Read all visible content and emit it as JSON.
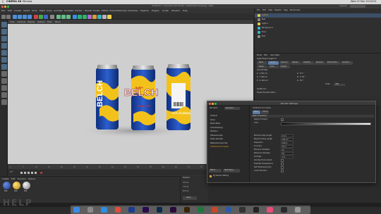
{
  "menubar": {
    "app": "CINEMA 4D",
    "window_menu": "Window",
    "clock": "Wed 22 Mar  10:23:01"
  },
  "titlebar": {
    "title": "Untitled 1 * [Cinema 4D Studio - Restricted License] - Main",
    "layout_label": "Layout:"
  },
  "c4d_menu": [
    "File",
    "Edit",
    "Create",
    "Select",
    "Tools",
    "Mesh",
    "Snap",
    "Animate",
    "Simulate",
    "Tracker",
    "Render",
    "Sculpt",
    "Motion Tracker",
    "MoGraph",
    "Character",
    "Pipeline",
    "Plugins",
    "Script",
    "Window",
    "Help"
  ],
  "viewport": {
    "menu": [
      "View",
      "Cameras",
      "Display",
      "Options",
      "Filter",
      "Panel"
    ]
  },
  "cans": {
    "brand": "BELCH",
    "sub": "SODA POP",
    "badge": "BURP!",
    "volume": "12 FL OZ (355ml)"
  },
  "timeline": {
    "ticks": [
      "0",
      "5",
      "10",
      "15",
      "20",
      "25",
      "30",
      "35",
      "40",
      "45",
      "50",
      "55",
      "60",
      "65",
      "70",
      "75",
      "80",
      "85",
      "90"
    ],
    "frame_start": "0 F",
    "frame_end": "90 F"
  },
  "materials": {
    "menu": [
      "Create",
      "Edit",
      "Function",
      "Texture"
    ],
    "items": [
      {
        "name": "Mat",
        "color": "#2f5bb5"
      },
      {
        "name": "Mat",
        "color": "#f0c21a"
      },
      {
        "name": "Mat",
        "color": "#c9c9c9"
      }
    ]
  },
  "coords": {
    "title": "Position",
    "rows": [
      "X 0 cm",
      "Y 0 cm",
      "Z 0 cm"
    ],
    "apply": "Apply"
  },
  "objects": {
    "menu": [
      "File",
      "Edit",
      "View",
      "Objects",
      "Tags",
      "Bookmarks"
    ],
    "items": [
      "Light.2",
      "Null",
      "Light.1",
      "Background",
      "Floor",
      "Null"
    ]
  },
  "attributes": {
    "menu": [
      "Mode",
      "Edit",
      "User Data"
    ],
    "object_name": "Light Object [Light.2]",
    "tabs": [
      "Basic",
      "Coord.",
      "General",
      "Details",
      "Visibility",
      "Shadow",
      "Photometric",
      "Caustics",
      "Noise",
      "Lens",
      "Project"
    ],
    "coord_header": "Coordinates",
    "coord_fields": [
      "P . X  200 cm",
      "P . Y  400 cm",
      "P . Z  -400 cm"
    ],
    "rot_fields": [
      "R . H  0 °",
      "R . P  -30 °",
      "R . B  0 °"
    ],
    "order_label": "Order",
    "order_value": "HPB",
    "quaternion": "Quaternion",
    "freeze": "Freeze Transformation"
  },
  "render": {
    "title": "Render Settings",
    "renderer_label": "Renderer",
    "renderer_value": "Standard",
    "left_items": [
      "Output",
      "Save",
      "Multi-Pass",
      "Anti-Aliasing",
      "Options",
      "Stereoscopic",
      "Team Render",
      "Material Override",
      "Ambient Occlusion"
    ],
    "selected_index": 8,
    "panel_title": "Ambient Occlusion",
    "tabs": [
      "Basic",
      "Cache"
    ],
    "section": "Basic Properties",
    "props": [
      {
        "label": "Apply to Project",
        "value": "✓"
      },
      {
        "label": "Color",
        "value": ""
      },
      {
        "label": "Minimum Ray Length",
        "value": "0 cm"
      },
      {
        "label": "Maximum Ray Length",
        "value": "100 cm"
      },
      {
        "label": "Dispersion",
        "value": "100 %"
      },
      {
        "label": "Accuracy",
        "value": "50 %"
      },
      {
        "label": "Minimum Samples",
        "value": "10"
      },
      {
        "label": "Maximum Samples",
        "value": "64"
      },
      {
        "label": "Contrast",
        "value": "0 %"
      },
      {
        "label": "Use Sky Environment",
        "value": ""
      },
      {
        "label": "Evaluate Transparency",
        "value": ""
      },
      {
        "label": "Self Shadowing Only",
        "value": ""
      },
      {
        "label": "Invert Direction",
        "value": ""
      }
    ],
    "buttons": [
      "Effect...",
      "Multi-Pass...",
      "Render Setting...",
      "Load Preset...",
      "Save"
    ],
    "preset_label": "My Render Setting"
  },
  "footer": {
    "logo": "HELP"
  },
  "dock": [
    {
      "name": "finder",
      "color": "#3c8be6"
    },
    {
      "name": "launchpad",
      "color": "#8a8a8a"
    },
    {
      "name": "safari",
      "color": "#2f8ee0"
    },
    {
      "name": "chrome",
      "color": "#e44c3a"
    },
    {
      "name": "cinema4d",
      "color": "#1b3d8f"
    },
    {
      "name": "premiere",
      "color": "#2a0a4a"
    },
    {
      "name": "photoshop",
      "color": "#0c2a4a"
    },
    {
      "name": "aftereffects",
      "color": "#2a0a3a"
    },
    {
      "name": "illustrator",
      "color": "#3a2300"
    },
    {
      "name": "excel",
      "color": "#1d7a3a"
    },
    {
      "name": "powerpoint",
      "color": "#c4482a"
    },
    {
      "name": "word",
      "color": "#2a5aa8"
    },
    {
      "name": "finalcut",
      "color": "#333"
    },
    {
      "name": "obs",
      "color": "#222"
    },
    {
      "name": "itunes",
      "color": "#e94e77"
    },
    {
      "name": "quicktime",
      "color": "#2a2a2a"
    },
    {
      "name": "trash",
      "color": "#9a9a9a"
    }
  ]
}
